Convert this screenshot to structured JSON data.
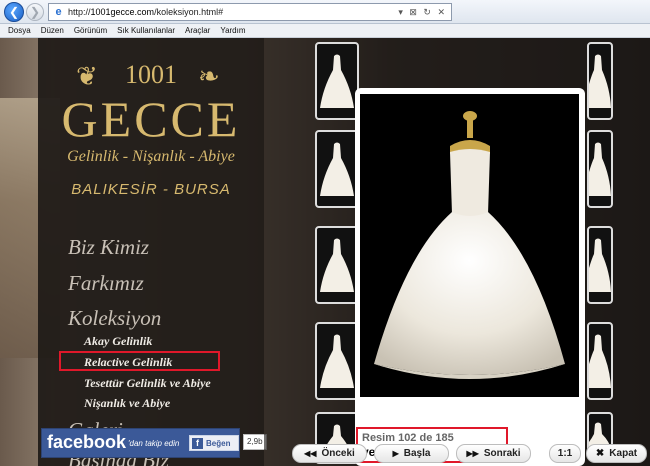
{
  "browser": {
    "url_host": "1001gecce.com",
    "url_prefix": "http://",
    "url_path": "/koleksiyon.html#",
    "toolbar_glyphs": "▾ ⊠ ↻ ✕"
  },
  "menubar": {
    "items": [
      "Dosya",
      "Düzen",
      "Görünüm",
      "Sık Kullanılanlar",
      "Araçlar",
      "Yardım"
    ]
  },
  "logo": {
    "number": "1001",
    "name": "GECCE",
    "tagline": "Gelinlik - Nişanlık - Abiye",
    "cities": "BALIKESİR - BURSA"
  },
  "nav": {
    "main": [
      "Biz Kimiz",
      "Farkımız",
      "Koleksiyon"
    ],
    "sub": [
      "Akay Gelinlik",
      "Relactive Gelinlik",
      "Tesettür Gelinlik ve Abiye",
      "Nişanlık ve Abiye"
    ],
    "partial": [
      "Galeri",
      "Basında Biz"
    ]
  },
  "facebook": {
    "logo": "facebook",
    "text": "'dan takip edin",
    "like": "Beğen",
    "count": "2,9b"
  },
  "lightbox": {
    "counter": "Resim 102 de 185",
    "name": "yeni_urun_192"
  },
  "controls": {
    "prev": "Önceki",
    "start": "Başla",
    "next": "Sonraki",
    "ratio": "1:1",
    "close": "Kapat"
  },
  "colors": {
    "gold": "#d7b96f",
    "highlight_red": "#e0182a",
    "facebook_blue": "#3b5998"
  }
}
